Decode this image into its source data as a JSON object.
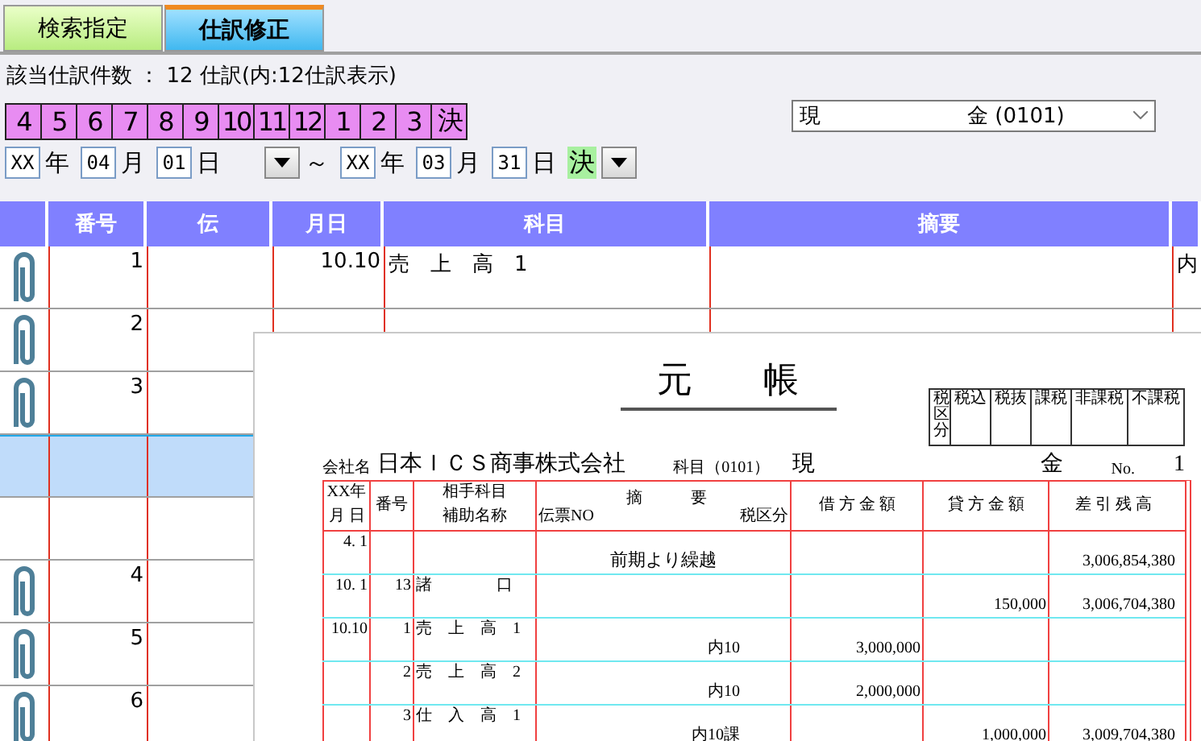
{
  "tabs": [
    {
      "label": "検索指定",
      "selected": false
    },
    {
      "label": "仕訳修正",
      "selected": true
    }
  ],
  "count_text": "該当仕訳件数 ： 12 仕訳(内:12仕訳表示)",
  "months": [
    "4",
    "5",
    "6",
    "7",
    "8",
    "9",
    "10",
    "11",
    "12",
    "1",
    "2",
    "3",
    "決"
  ],
  "account_select": {
    "value": "現　　　　　　　金 (0101)"
  },
  "date_from": [
    {
      "value": "XX",
      "unit": "年"
    },
    {
      "value": "04",
      "unit": "月"
    },
    {
      "value": "01",
      "unit": "日"
    }
  ],
  "range_separator": "～",
  "date_to": [
    {
      "value": "XX",
      "unit": "年"
    },
    {
      "value": "03",
      "unit": "月"
    },
    {
      "value": "31",
      "unit": "日"
    }
  ],
  "closing_button": "決",
  "table": {
    "columns": [
      "",
      "番号",
      "伝",
      "月日",
      "科目",
      "摘要",
      ""
    ],
    "rows": [
      {
        "kind": "entry",
        "number": "1",
        "date": "10.10",
        "account": "売　上　高　1",
        "column_7": "内",
        "selected": false
      },
      {
        "kind": "entry",
        "number": "2",
        "selected": false
      },
      {
        "kind": "entry",
        "number": "3",
        "selected": false
      },
      {
        "kind": "blank",
        "selected": true
      },
      {
        "kind": "blank",
        "selected": false
      },
      {
        "kind": "entry",
        "number": "4",
        "selected": false
      },
      {
        "kind": "entry",
        "number": "5",
        "selected": false
      },
      {
        "kind": "entry",
        "number": "6",
        "selected": false
      }
    ]
  },
  "preview": {
    "title": "元　　帳",
    "tax_box": [
      "税区分",
      "税込",
      "税抜",
      "課税",
      "非課税",
      "不課税"
    ],
    "company_label": "会社名",
    "company": "日本ＩＣＳ商事株式会社",
    "account_label": "科目（0101）",
    "account_name": [
      "現",
      "金"
    ],
    "page_label": "No.",
    "page_number": "1",
    "header": {
      "year": "XX年",
      "month_day": "月 日",
      "number": "番号",
      "counter_account": "相手科目",
      "sub_name": "補助名称",
      "slip_no": "伝票NO",
      "summary": "摘　　　要",
      "tax_class": "税区分",
      "debit": "借 方 金 額",
      "credit": "貸 方 金 額",
      "balance": "差 引 残 高"
    },
    "rows": [
      {
        "date": "4. 1",
        "number": "",
        "account": "",
        "summary": "前期より繰越",
        "tax": "",
        "debit": "",
        "credit": "",
        "balance": "3,006,854,380"
      },
      {
        "date": "10. 1",
        "number": "13",
        "account": "諸　　　　口",
        "summary": "",
        "tax": "",
        "debit": "",
        "credit": "150,000",
        "balance": "3,006,704,380"
      },
      {
        "date": "10.10",
        "number": "1",
        "account": "売　上　高　1",
        "summary": "",
        "tax": "内10",
        "debit": "3,000,000",
        "credit": "",
        "balance": ""
      },
      {
        "date": "",
        "number": "2",
        "account": "売　上　高　2",
        "summary": "",
        "tax": "内10",
        "debit": "2,000,000",
        "credit": "",
        "balance": ""
      },
      {
        "date": "",
        "number": "3",
        "account": "仕　入　高　1",
        "summary": "",
        "tax": "内10課",
        "debit": "",
        "credit": "1,000,000",
        "balance": "3,009,704,380"
      }
    ]
  }
}
